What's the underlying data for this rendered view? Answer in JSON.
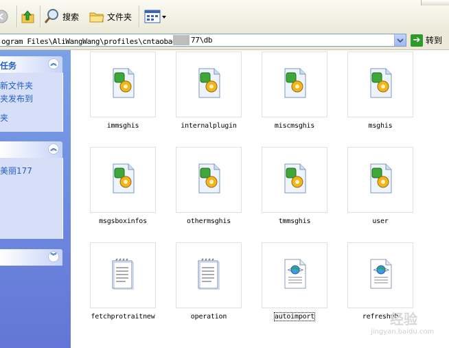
{
  "toolbar": {
    "search_label": "搜索",
    "folders_label": "文件夹"
  },
  "address": {
    "path_left": "ogram Files\\AliWangWang\\profiles\\cntaobao美",
    "path_right": "77\\db",
    "go_label": "转到"
  },
  "sidebar": {
    "panel1": {
      "title": "任务",
      "links": [
        "新文件夹",
        "夹发布到",
        "夹"
      ]
    },
    "panel2": {
      "links": [
        "美丽177"
      ]
    }
  },
  "files": [
    {
      "name": "immsghis",
      "type": "db"
    },
    {
      "name": "internalplugin",
      "type": "db"
    },
    {
      "name": "miscmsghis",
      "type": "db"
    },
    {
      "name": "msghis",
      "type": "db"
    },
    {
      "name": "msgsboxinfos",
      "type": "db"
    },
    {
      "name": "othermsghis",
      "type": "db"
    },
    {
      "name": "tmmsghis",
      "type": "db"
    },
    {
      "name": "user",
      "type": "db"
    },
    {
      "name": "fetchprotraitnew",
      "type": "text"
    },
    {
      "name": "operation",
      "type": "text"
    },
    {
      "name": "autoimport",
      "type": "web"
    },
    {
      "name": "refreshub",
      "type": "web"
    }
  ],
  "watermark": {
    "line1": "经验",
    "line2": "jingyan.baidu.com"
  },
  "colors": {
    "sidebar": "#6f8ede",
    "link": "#215dc6",
    "toolbar": "#ece9d8"
  }
}
